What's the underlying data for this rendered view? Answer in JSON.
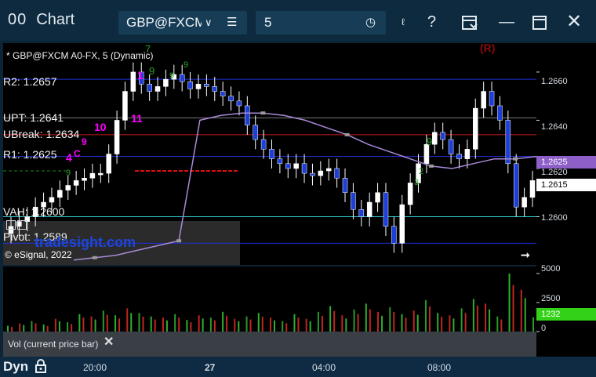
{
  "toolbar": {
    "app_glyph": "00",
    "title": "Chart",
    "symbol": "GBP@FXCM",
    "interval": "5"
  },
  "chart_header": "* GBP@FXCM A0-FX, 5 (Dynamic)",
  "levels": [
    {
      "label": "R2: 1.2657",
      "price": 1.2657,
      "color": "#1f2fd6"
    },
    {
      "label": "UPT: 1.2641",
      "price": 1.2641,
      "color": "#7a7a7a"
    },
    {
      "label": "UBreak: 1.2634",
      "price": 1.2634,
      "color": "#c41c1c"
    },
    {
      "label": "R1: 1.2625",
      "price": 1.2625,
      "color": "#1f2fd6"
    },
    {
      "label": "VAH: 1.2600",
      "price": 1.26,
      "color": "#2fd0d8"
    },
    {
      "label": "Pivot: 1.2589",
      "price": 1.2589,
      "color": "#1f2fd6"
    }
  ],
  "watermark": "© eSignal, 2022",
  "site_watermark": "tradesight.com",
  "annotations": {
    "magenta": [
      "1",
      "11",
      "10",
      "9",
      "4",
      "C"
    ],
    "green": [
      "7",
      "9",
      "9",
      "9",
      "9",
      "2",
      "3",
      "9"
    ],
    "signal": "(R)"
  },
  "price_axis": {
    "ticks": [
      "1.2660",
      "1.2640",
      "1.2620",
      "1.2600"
    ],
    "tick_values": [
      1.266,
      1.264,
      1.262,
      1.26
    ],
    "tags": [
      {
        "text": "1.2625",
        "value": 1.2625,
        "bg": "#8e5fc8",
        "fg": "#ffffff"
      },
      {
        "text": "1.2615",
        "value": 1.2615,
        "bg": "#ffffff",
        "fg": "#000000"
      }
    ],
    "range": [
      1.258,
      1.2672
    ]
  },
  "volume_axis": {
    "ticks": [
      "5000",
      "2500",
      "0"
    ],
    "tick_values": [
      5000,
      2500,
      0
    ],
    "tag": "1232",
    "tag_bg": "#33d117",
    "range": [
      0,
      5200
    ]
  },
  "volume_label": "Vol (current price bar)",
  "time_axis": {
    "labels": [
      "20:00",
      "27",
      "04:00",
      "08:00"
    ]
  },
  "footer": {
    "dyn": "Dyn"
  },
  "chart_data": [
    {
      "type": "candlestick",
      "title": "* GBP@FXCM A0-FX, 5 (Dynamic)",
      "xlabel": "",
      "ylabel": "",
      "ylim": [
        1.258,
        1.2672
      ],
      "x_ticks": [
        "20:00",
        "27",
        "04:00",
        "08:00"
      ],
      "y_ticks": [
        1.266,
        1.264,
        1.262,
        1.26
      ],
      "series": [
        {
          "name": "",
          "values": [
            1.2596,
            1.2598,
            1.26,
            1.2604,
            1.2606,
            1.2608,
            1.2611,
            1.2613,
            1.2615,
            1.2616,
            1.2618,
            1.2618,
            1.2626,
            1.264,
            1.2652,
            1.266,
            1.2655,
            1.2652,
            1.2654,
            1.2657,
            1.2659,
            1.2656,
            1.2653,
            1.2655,
            1.2654,
            1.2652,
            1.265,
            1.2648,
            1.2646,
            1.2638,
            1.2632,
            1.2628,
            1.2624,
            1.2622,
            1.262,
            1.2622,
            1.2618,
            1.2617,
            1.2619,
            1.262,
            1.2616,
            1.261,
            1.2603,
            1.26,
            1.2606,
            1.261,
            1.2596,
            1.2589,
            1.2605,
            1.2614,
            1.2622,
            1.263,
            1.2635,
            1.2632,
            1.2626,
            1.2624,
            1.2628,
            1.2645,
            1.2652,
            1.2646,
            1.264,
            1.2622,
            1.2604,
            1.2608,
            1.2615
          ]
        }
      ],
      "overlays": [
        {
          "name": "VWAP",
          "color": "#a98ad8",
          "values": [
            1.2582,
            1.2583,
            1.2584,
            1.2586,
            1.2588,
            1.259,
            1.264,
            1.2642,
            1.2643,
            1.2643,
            1.2642,
            1.264,
            1.2637,
            1.2634,
            1.263,
            1.2627,
            1.2624,
            1.2621,
            1.262,
            1.2622,
            1.2624,
            1.2624,
            1.2625
          ]
        }
      ]
    },
    {
      "type": "bar",
      "title": "Vol (current price bar)",
      "xlabel": "",
      "ylabel": "",
      "ylim": [
        0,
        5200
      ],
      "y_ticks": [
        5000,
        2500,
        0
      ],
      "series": [
        {
          "name": "",
          "values": [
            500,
            700,
            900,
            600,
            1100,
            800,
            1500,
            1300,
            1800,
            1400,
            2000,
            1600,
            1300,
            1200,
            1500,
            1000,
            1400,
            1200,
            1700,
            1100,
            1300,
            1600,
            1200,
            900,
            1500,
            1100,
            1700,
            2200,
            1400,
            1900,
            2400,
            1700,
            2100,
            1500,
            1800,
            2700,
            1600,
            1400,
            2000,
            2800,
            2400,
            1300,
            5000,
            3600,
            1232
          ]
        }
      ]
    }
  ]
}
